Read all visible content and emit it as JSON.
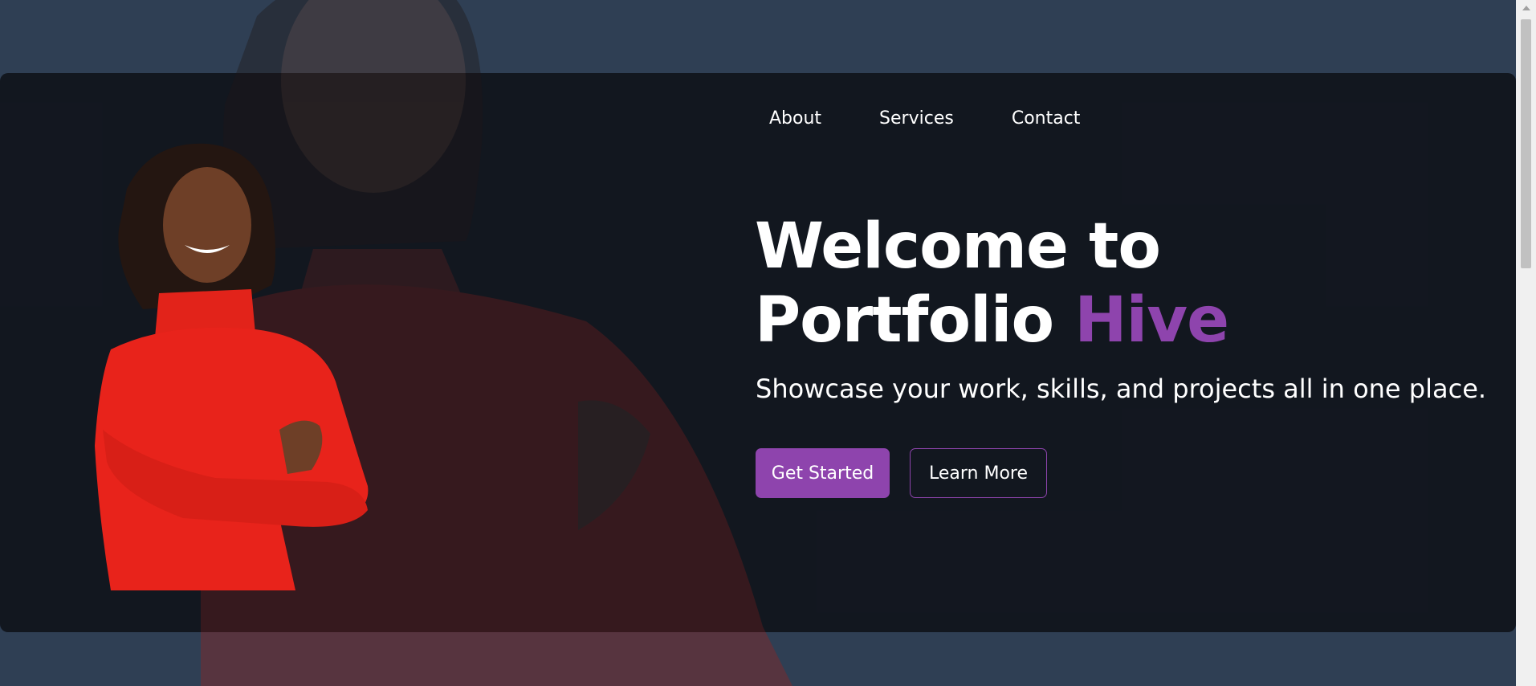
{
  "nav": {
    "items": [
      {
        "label": "About"
      },
      {
        "label": "Services"
      },
      {
        "label": "Contact"
      }
    ]
  },
  "hero": {
    "headline_line1": "Welcome to",
    "headline_line2_prefix": "Portfolio ",
    "headline_line2_accent": "Hive",
    "subtitle": "Showcase your work, skills, and projects all in one place.",
    "primary_button": "Get Started",
    "secondary_button": "Learn More"
  },
  "colors": {
    "accent": "#8e44ad",
    "page_background": "#2f3f54",
    "hero_background": "#12161e",
    "sweater_red": "#e8231b"
  },
  "icons": {
    "scroll_up": "chevron-up-icon"
  }
}
